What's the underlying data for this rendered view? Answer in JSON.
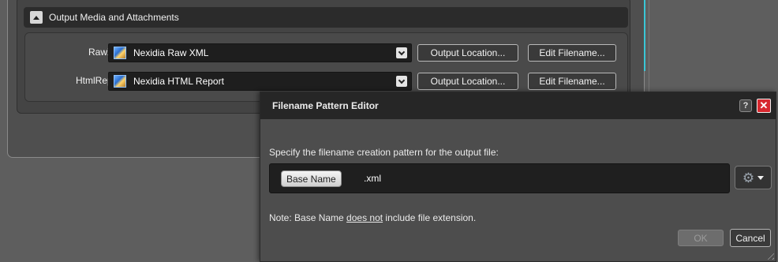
{
  "section": {
    "title": "Output Media and Attachments",
    "rows": [
      {
        "label": "RawXml:",
        "value": "Nexidia Raw XML",
        "output_location_label": "Output Location...",
        "edit_filename_label": "Edit Filename..."
      },
      {
        "label": "HtmlReport:",
        "value": "Nexidia HTML Report",
        "output_location_label": "Output Location...",
        "edit_filename_label": "Edit Filename..."
      }
    ]
  },
  "dialog": {
    "title": "Filename Pattern Editor",
    "help_label": "?",
    "close_label": "✕",
    "instruction": "Specify the filename creation pattern for the output file:",
    "pattern": {
      "token": "Base Name",
      "suffix": ".xml"
    },
    "gear_glyph": "⚙",
    "note_prefix": "Note: Base Name ",
    "note_emphasis": "does not",
    "note_suffix": " include file extension.",
    "ok_label": "OK",
    "cancel_label": "Cancel",
    "ok_enabled": false
  },
  "colors": {
    "accent_cyan": "#39c6d6",
    "close_red": "#d7282f"
  }
}
